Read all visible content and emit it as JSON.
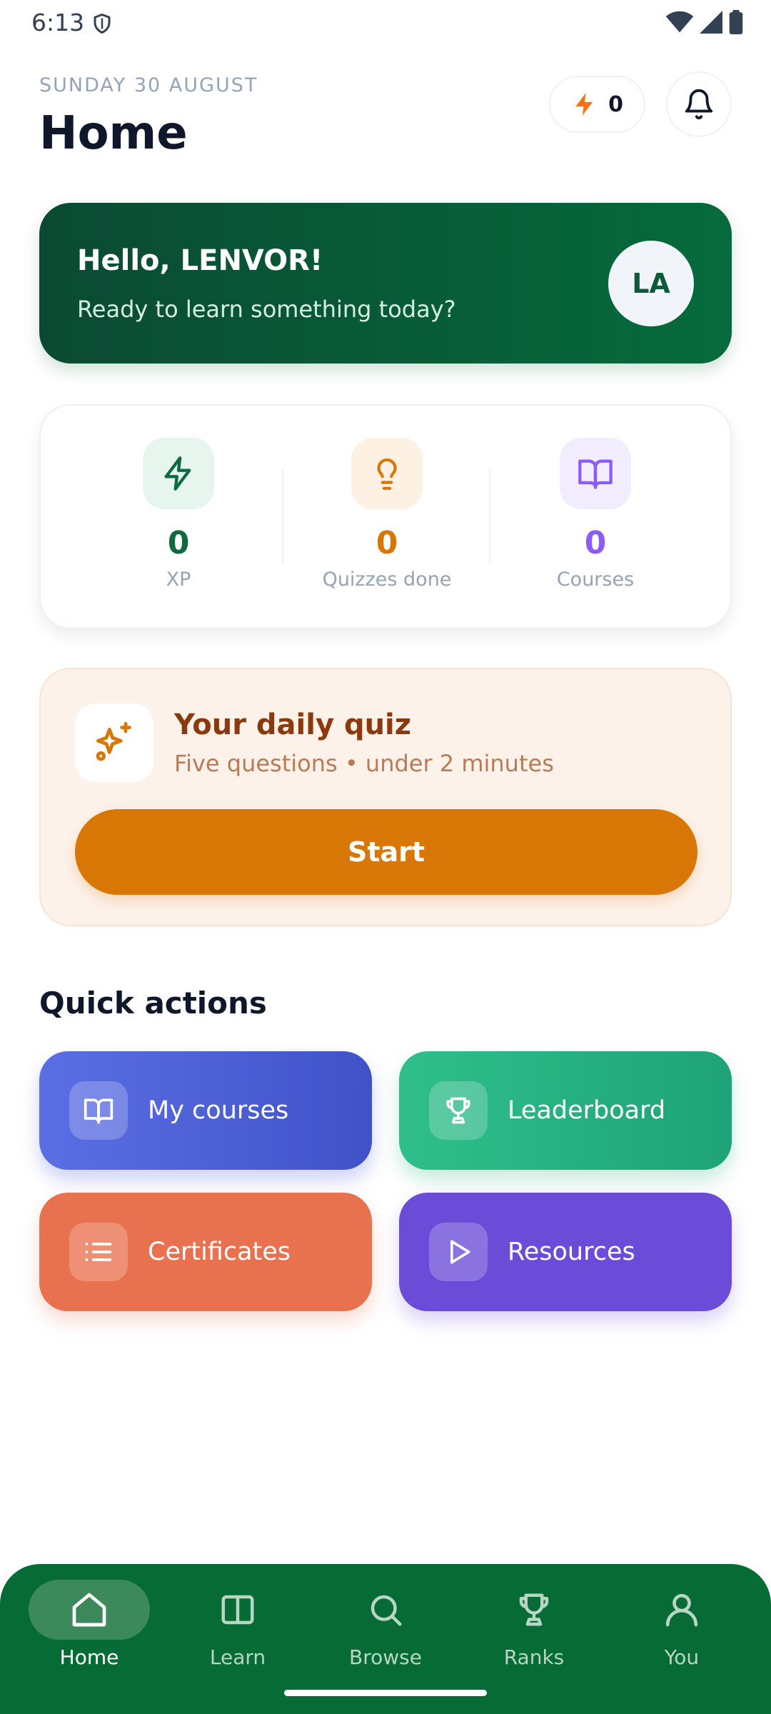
{
  "status_bar": {
    "time": "6:13"
  },
  "header": {
    "date": "SUNDAY 30 AUGUST",
    "title": "Home",
    "streak_count": "0"
  },
  "greeting": {
    "title": "Hello, LENVOR!",
    "subtitle": "Ready to learn something today?",
    "avatar_initials": "LA"
  },
  "stats": [
    {
      "value": "0",
      "label": "XP",
      "color": "#0d6b3f",
      "icon": "lightning-icon"
    },
    {
      "value": "0",
      "label": "Quizzes done",
      "color": "#d97706",
      "icon": "lightbulb-icon"
    },
    {
      "value": "0",
      "label": "Courses",
      "color": "#8b5cf6",
      "icon": "book-icon"
    }
  ],
  "daily_quiz": {
    "title": "Your daily quiz",
    "subtitle": "Five questions • under 2 minutes",
    "button": "Start"
  },
  "quick_actions": {
    "heading": "Quick actions",
    "items": [
      {
        "label": "My courses",
        "icon": "book-icon"
      },
      {
        "label": "Leaderboard",
        "icon": "trophy-icon"
      },
      {
        "label": "Certificates",
        "icon": "list-icon"
      },
      {
        "label": "Resources",
        "icon": "play-icon"
      }
    ]
  },
  "nav": {
    "items": [
      {
        "label": "Home",
        "icon": "home-icon",
        "active": true
      },
      {
        "label": "Learn",
        "icon": "columns-icon",
        "active": false
      },
      {
        "label": "Browse",
        "icon": "search-icon",
        "active": false
      },
      {
        "label": "Ranks",
        "icon": "trophy-icon",
        "active": false
      },
      {
        "label": "You",
        "icon": "user-icon",
        "active": false
      }
    ]
  },
  "colors": {
    "brand": "#066b35",
    "accent": "#d97706"
  }
}
